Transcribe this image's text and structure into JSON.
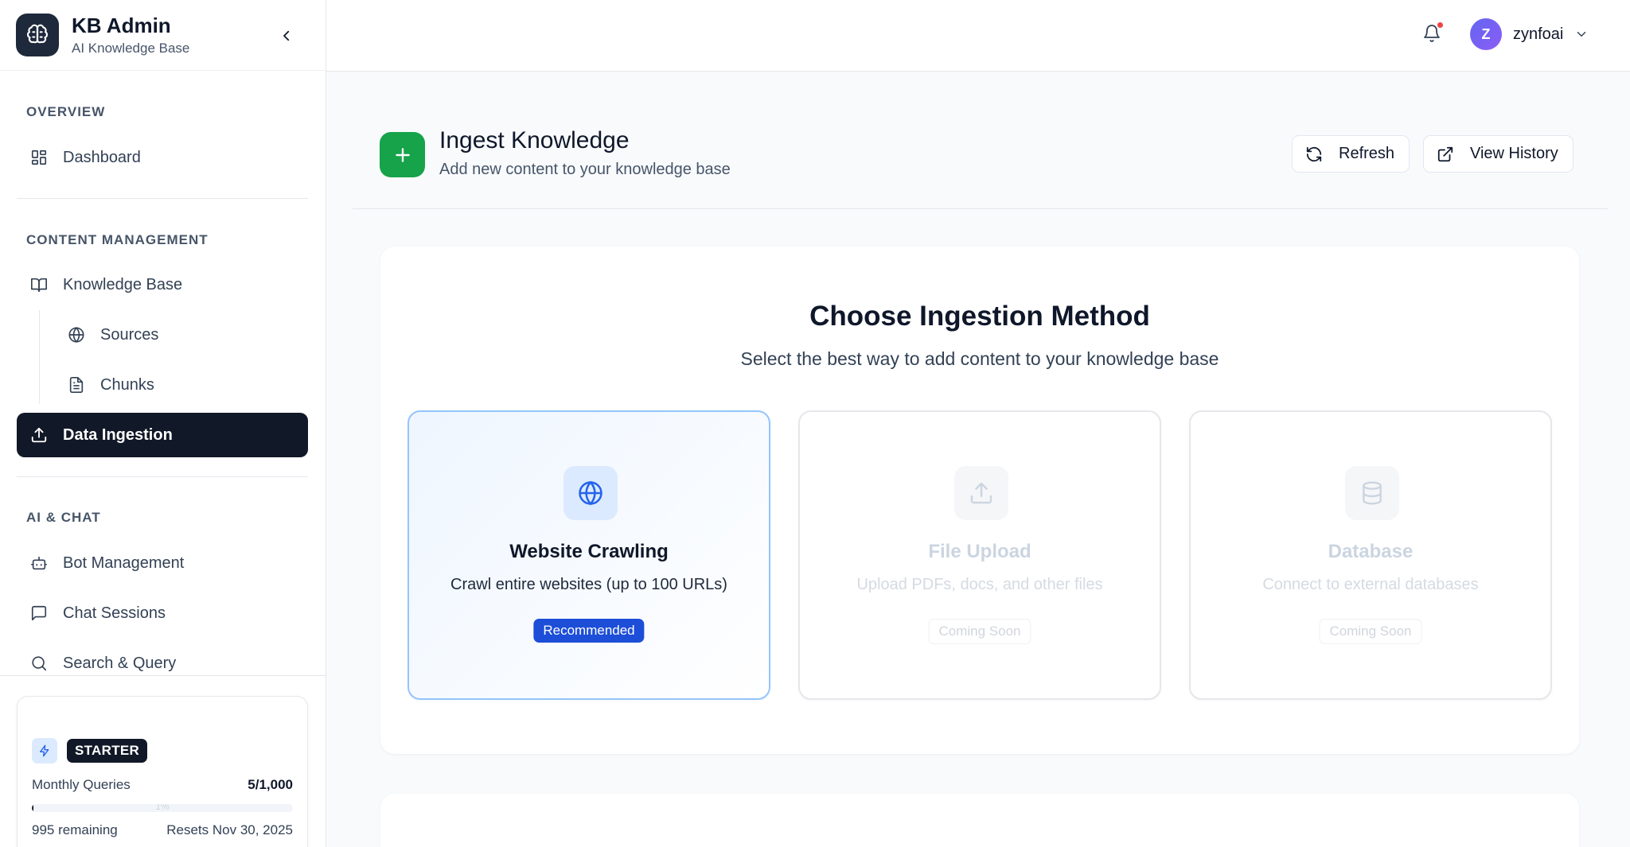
{
  "brand": {
    "title": "KB Admin",
    "subtitle": "AI Knowledge Base"
  },
  "sidebar": {
    "sections": [
      {
        "label": "OVERVIEW"
      },
      {
        "label": "CONTENT MANAGEMENT"
      },
      {
        "label": "AI & CHAT"
      }
    ],
    "items": {
      "dashboard": "Dashboard",
      "knowledge_base": "Knowledge Base",
      "sources": "Sources",
      "chunks": "Chunks",
      "data_ingestion": "Data Ingestion",
      "bot_management": "Bot Management",
      "chat_sessions": "Chat Sessions",
      "search_query": "Search & Query"
    },
    "active": "data_ingestion"
  },
  "plan": {
    "badge": "STARTER",
    "metric_label": "Monthly Queries",
    "metric_value": "5/1,000",
    "progress_fraction": 0.005,
    "progress_label": "1%",
    "remaining": "995 remaining",
    "resets": "Resets Nov 30, 2025"
  },
  "topbar": {
    "user_initial": "Z",
    "user_name": "zynfoai",
    "has_notification": true
  },
  "page": {
    "title": "Ingest Knowledge",
    "subtitle": "Add new content to your knowledge base",
    "refresh_label": "Refresh",
    "history_label": "View History"
  },
  "method": {
    "title": "Choose Ingestion Method",
    "subtitle": "Select the best way to add content to your knowledge base",
    "options": [
      {
        "title": "Website Crawling",
        "desc": "Crawl entire websites (up to 100 URLs)",
        "badge": "Recommended",
        "icon": "globe-icon"
      },
      {
        "title": "File Upload",
        "desc": "Upload PDFs, docs, and other files",
        "badge": "Coming Soon",
        "icon": "upload-icon"
      },
      {
        "title": "Database",
        "desc": "Connect to external databases",
        "badge": "Coming Soon",
        "icon": "database-icon"
      }
    ]
  },
  "colors": {
    "accent": "#1d4ed8",
    "ingest_green": "#16a34a",
    "active_nav": "#111827",
    "notification": "#ef4444"
  }
}
